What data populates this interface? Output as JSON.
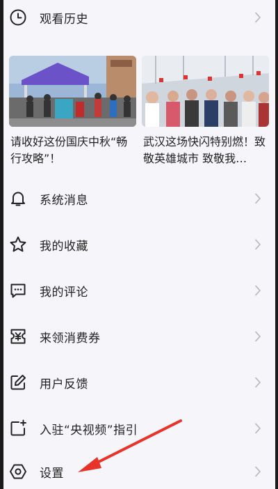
{
  "menu": {
    "history": {
      "label": "观看历史",
      "icon": "clock-icon"
    },
    "items": [
      {
        "id": "system-messages",
        "label": "系统消息",
        "icon": "bell-icon"
      },
      {
        "id": "favorites",
        "label": "我的收藏",
        "icon": "star-icon"
      },
      {
        "id": "comments",
        "label": "我的评论",
        "icon": "comment-icon"
      },
      {
        "id": "coupons",
        "label": "来领消费券",
        "icon": "coupon-icon"
      },
      {
        "id": "feedback",
        "label": "用户反馈",
        "icon": "edit-icon"
      },
      {
        "id": "join-guide",
        "label": "入驻“央视频”指引",
        "icon": "add-post-icon"
      },
      {
        "id": "settings",
        "label": "设置",
        "icon": "settings-icon"
      }
    ]
  },
  "cards": [
    {
      "title": "请收好这份国庆中秋“畅行攻略”！"
    },
    {
      "title": "武汉这场快闪特别燃！致敬英雄城市 致敬我…"
    }
  ],
  "colors": {
    "annotation_arrow": "#e8332a",
    "text": "#222222",
    "background": "#f6f5f9"
  }
}
